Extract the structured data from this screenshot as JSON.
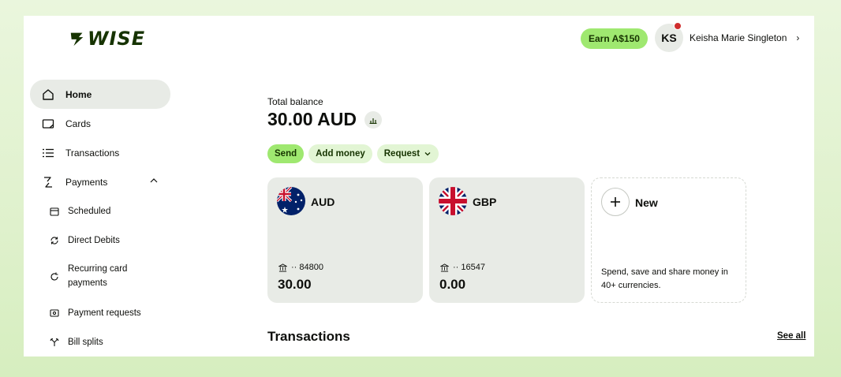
{
  "brand": {
    "logo_text": "WISE",
    "accent": "#9fe870",
    "brand_dark": "#163300"
  },
  "header": {
    "earn_label": "Earn A$150",
    "user_initials": "KS",
    "user_name": "Keisha Marie Singleton",
    "chevron": "›"
  },
  "sidebar": {
    "items": [
      {
        "label": "Home",
        "icon": "home-icon",
        "active": true
      },
      {
        "label": "Cards",
        "icon": "card-icon"
      },
      {
        "label": "Transactions",
        "icon": "list-icon"
      },
      {
        "label": "Payments",
        "icon": "payments-arrows-icon",
        "expanded": true
      }
    ],
    "sub_items": [
      {
        "label": "Scheduled",
        "icon": "calendar-icon"
      },
      {
        "label": "Direct Debits",
        "icon": "refresh-icon"
      },
      {
        "label": "Recurring card payments",
        "icon": "recurring-icon"
      },
      {
        "label": "Payment requests",
        "icon": "request-icon"
      },
      {
        "label": "Bill splits",
        "icon": "split-icon"
      }
    ]
  },
  "balance": {
    "label": "Total balance",
    "amount": "30.00 AUD"
  },
  "actions": {
    "send": "Send",
    "add_money": "Add money",
    "request": "Request"
  },
  "accounts": [
    {
      "code": "AUD",
      "account": "·· 84800",
      "amount": "30.00",
      "flag": "australia-flag-icon"
    },
    {
      "code": "GBP",
      "account": "·· 16547",
      "amount": "0.00",
      "flag": "uk-flag-icon"
    }
  ],
  "new_card": {
    "label": "New",
    "description": "Spend, save and share money in 40+ currencies."
  },
  "transactions": {
    "title": "Transactions",
    "see_all": "See all"
  }
}
